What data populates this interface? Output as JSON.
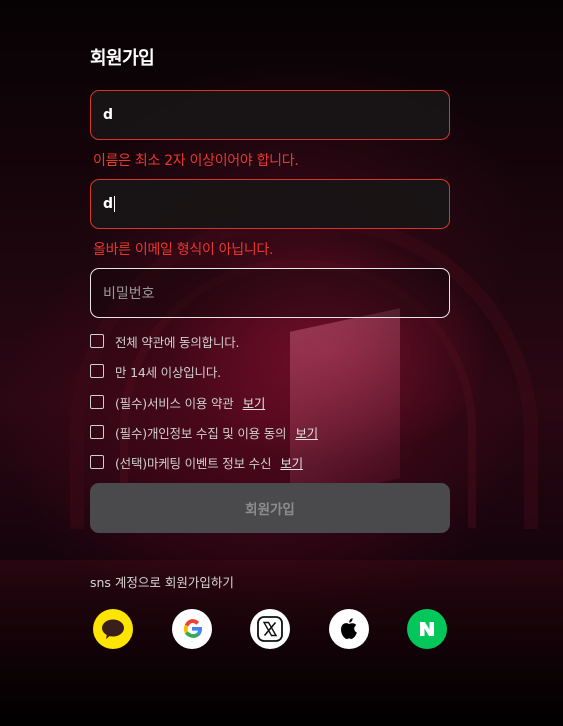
{
  "form": {
    "title": "회원가입",
    "name_field": {
      "value": "d",
      "error": "이름은 최소 2자 이상이어야 합니다."
    },
    "email_field": {
      "value": "d",
      "error": "올바른 이메일 형식이 아닙니다."
    },
    "password_field": {
      "value": "",
      "placeholder": "비밀번호"
    },
    "agreements": [
      {
        "label": "전체 약관에 동의합니다.",
        "checked": false
      },
      {
        "label": "만 14세 이상입니다.",
        "checked": false
      },
      {
        "label": "(필수)서비스 이용 약관",
        "link": "보기",
        "checked": false
      },
      {
        "label": "(필수)개인정보 수집 및 이용 동의",
        "link": "보기",
        "checked": false
      },
      {
        "label": "(선택)마케팅 이벤트 정보 수신",
        "link": "보기",
        "checked": false
      }
    ],
    "submit_label": "회원가입"
  },
  "sns": {
    "title": "sns 계정으로 회원가입하기",
    "providers": [
      {
        "icon": "kakao-icon",
        "color": "#FEE500"
      },
      {
        "icon": "google-icon",
        "color": "#FFFFFF"
      },
      {
        "icon": "x-icon",
        "color": "#FFFFFF"
      },
      {
        "icon": "apple-icon",
        "color": "#FFFFFF"
      },
      {
        "icon": "naver-icon",
        "color": "#03C75A"
      }
    ]
  },
  "colors": {
    "error": "#E8382F",
    "submit_disabled": "#4A4A4C"
  }
}
